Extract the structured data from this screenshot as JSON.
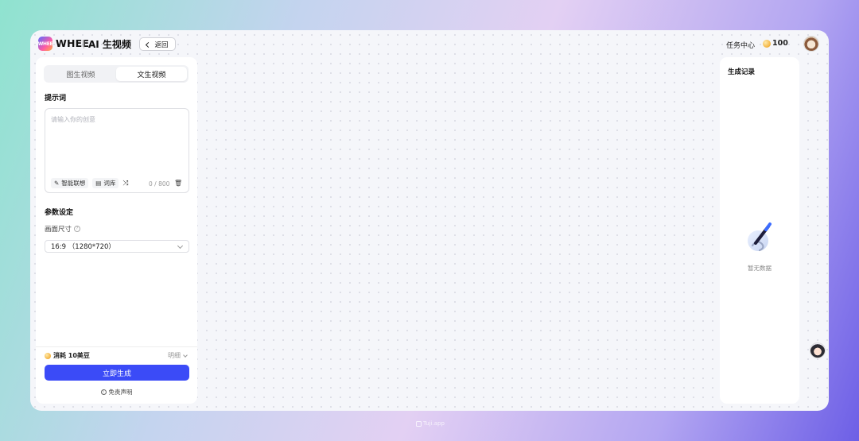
{
  "header": {
    "logo_text": "WHEE",
    "brand": "WHEE",
    "page_title": "AI 生视频",
    "back_label": "返回",
    "task_center": "任务中心",
    "beans": "100"
  },
  "left_panel": {
    "tabs": [
      {
        "label": "图生视频",
        "active": false
      },
      {
        "label": "文生视频",
        "active": true
      }
    ],
    "prompt": {
      "title": "提示词",
      "placeholder": "请输入你的创意",
      "tools": {
        "smart_assoc": "智能联想",
        "lexicon": "词库"
      },
      "counter": "0 / 800"
    },
    "params": {
      "title": "参数设定",
      "size_label": "画面尺寸",
      "size_value": "16:9 （1280*720）"
    },
    "footer": {
      "cost": "消耗 10美豆",
      "detail": "明细",
      "generate": "立即生成",
      "disclaimer": "免责声明"
    }
  },
  "right_panel": {
    "title": "生成记录",
    "empty_text": "暂无数据"
  },
  "watermark": "Tuji.app",
  "colors": {
    "accent": "#3b4bf7",
    "canvas": "#f5f6fa"
  },
  "icons": [
    "chevron-left-icon",
    "coin-icon",
    "lightbulb-icon",
    "book-icon",
    "shuffle-icon",
    "trash-icon",
    "help-icon",
    "chevron-down-icon",
    "info-icon",
    "pen-icon"
  ]
}
